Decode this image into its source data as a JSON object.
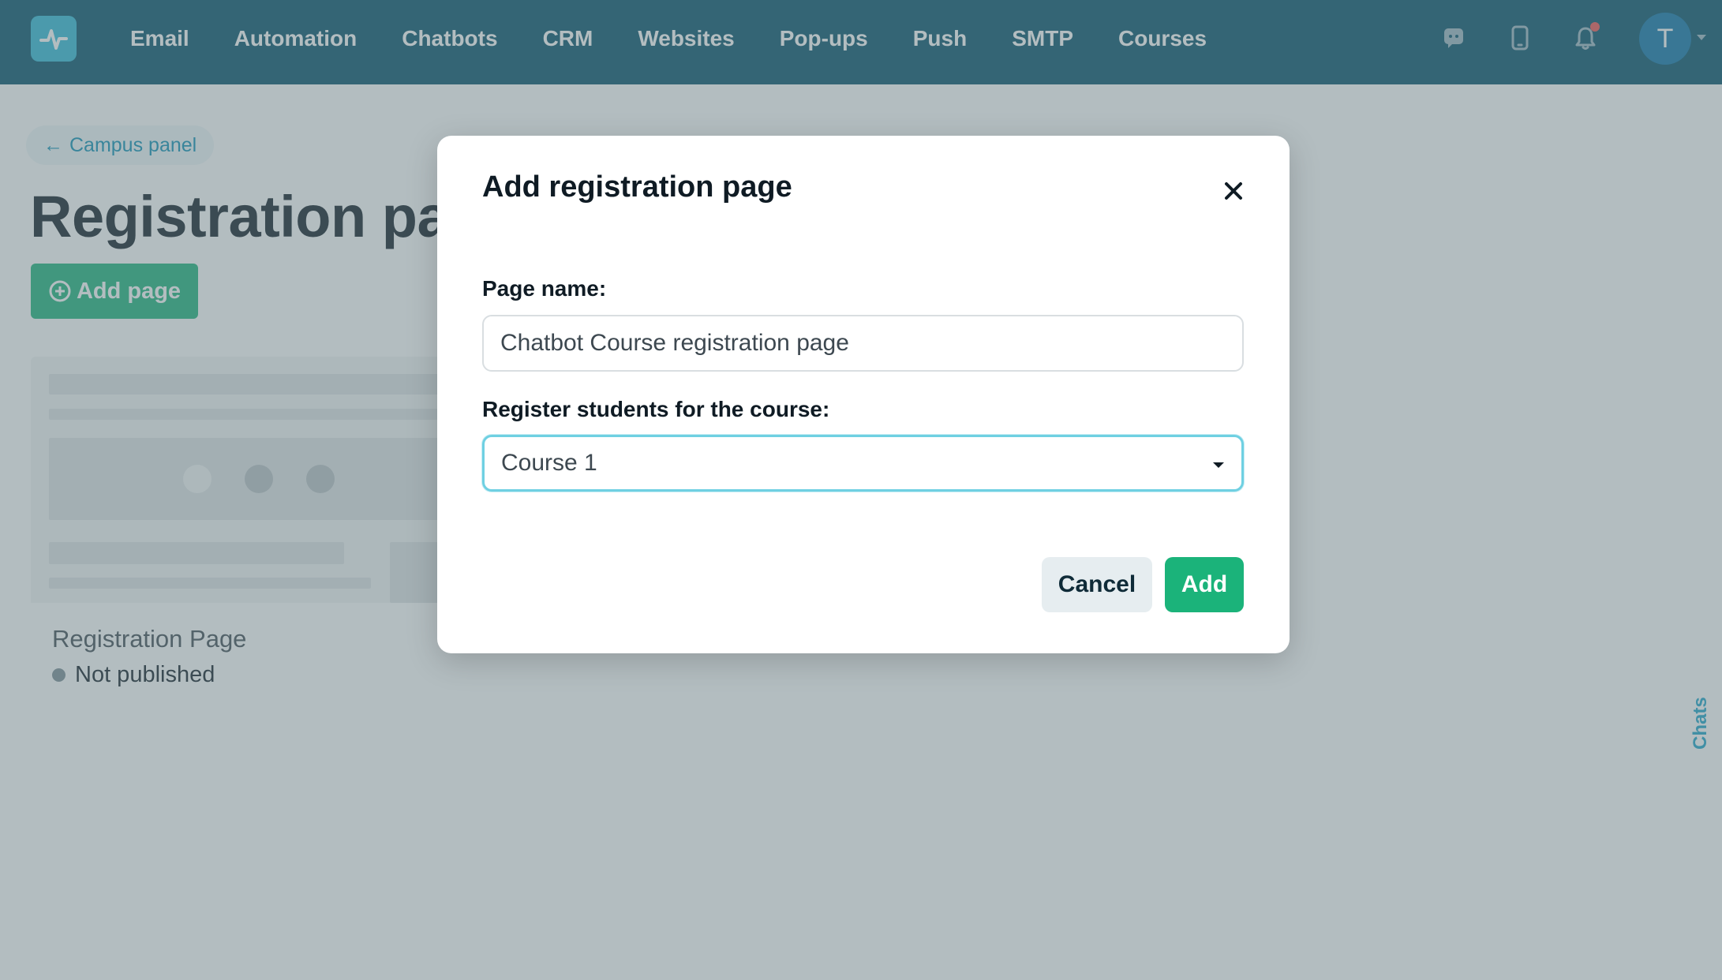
{
  "nav": {
    "items": [
      "Email",
      "Automation",
      "Chatbots",
      "CRM",
      "Websites",
      "Pop-ups",
      "Push",
      "SMTP",
      "Courses"
    ]
  },
  "user": {
    "avatar_initial": "T"
  },
  "page": {
    "back_link": "Campus panel",
    "title": "Registration pages",
    "add_button": "Add page",
    "card": {
      "name": "Registration Page",
      "status": "Not published"
    }
  },
  "chats_tab": "Chats",
  "modal": {
    "title": "Add registration page",
    "page_name_label": "Page name:",
    "page_name_value": "Chatbot Course registration page",
    "course_label": "Register students for the course:",
    "course_value": "Course 1",
    "cancel_label": "Cancel",
    "add_label": "Add"
  },
  "colors": {
    "topbar": "#014e68",
    "accent_green": "#1bb37a",
    "link_blue": "#0b8fb5",
    "notification": "#ef5350"
  }
}
